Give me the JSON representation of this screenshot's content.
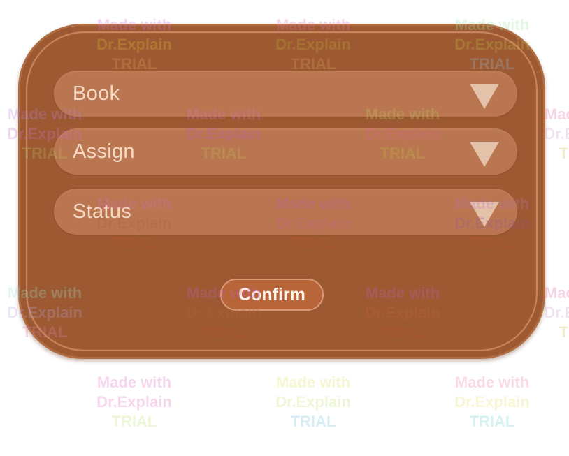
{
  "form": {
    "fields": [
      {
        "label": "Book"
      },
      {
        "label": "Assign"
      },
      {
        "label": "Status"
      }
    ],
    "confirm_label": "Confirm"
  },
  "watermark": {
    "line1": "Made with",
    "line2": "Dr.Explain",
    "line3": "TRIAL"
  },
  "colors": {
    "panel": "#9d5a32",
    "field": "#b97650",
    "accent": "#b8653a",
    "text": "#f3d8c3"
  },
  "icons": {
    "dropdown": "triangle-down-icon"
  }
}
